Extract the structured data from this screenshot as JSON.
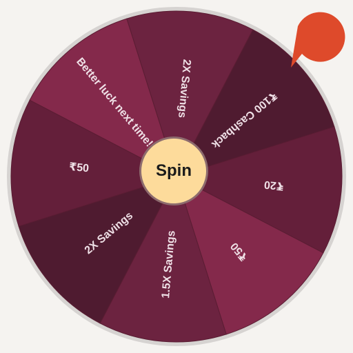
{
  "wheel": {
    "spin_label": "Spin",
    "pointer_icon": "teardrop-pointer-icon",
    "colors": {
      "background": "#f5f3f0",
      "rim": "#d6d3d1",
      "pointer": "#de4a2b",
      "hub": "#fddb9b",
      "hub_border": "#8d6b6e",
      "label": "#efe0e6"
    },
    "segments": [
      {
        "label": "2X Savings",
        "color": "#6c2340"
      },
      {
        "label": "₹100 Cashback",
        "color": "#4f1b30"
      },
      {
        "label": "₹20",
        "color": "#641f3a"
      },
      {
        "label": "₹50",
        "color": "#84294b"
      },
      {
        "label": "1.5X Savings",
        "color": "#6c2340"
      },
      {
        "label": "2X Savings",
        "color": "#4f1b30"
      },
      {
        "label": "₹50",
        "color": "#641f3a"
      },
      {
        "label": "Better luck next time!",
        "color": "#84294b"
      }
    ]
  }
}
